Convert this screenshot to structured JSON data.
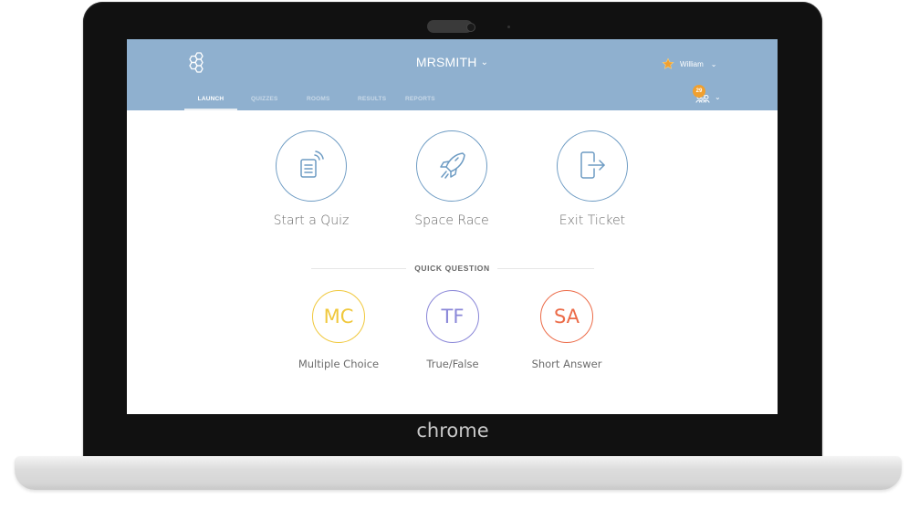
{
  "device": {
    "brand_label": "chrome"
  },
  "header": {
    "logo_icon": "hexagon-cluster-icon",
    "room_title": "MRSMITH",
    "room_chevron": "⌄",
    "tabs": [
      {
        "label": "LAUNCH",
        "active": true
      },
      {
        "label": "QUIZZES",
        "active": false
      },
      {
        "label": "ROOMS",
        "active": false
      },
      {
        "label": "RESULTS",
        "active": false
      },
      {
        "label": "REPORTS",
        "active": false
      }
    ],
    "user": {
      "icon": "star-icon",
      "name": "William",
      "chevron": "⌄"
    },
    "students": {
      "icon": "students-icon",
      "count": "29",
      "chevron": "⌄"
    }
  },
  "launch": {
    "items": [
      {
        "label": "Start a Quiz",
        "icon": "quiz-device-icon"
      },
      {
        "label": "Space Race",
        "icon": "rocket-icon"
      },
      {
        "label": "Exit Ticket",
        "icon": "exit-door-icon"
      }
    ],
    "accent_color": "#6d9bc3"
  },
  "quick_question": {
    "title": "QUICK QUESTION",
    "items": [
      {
        "abbr": "MC",
        "label": "Multiple Choice",
        "color": "#f0c83c"
      },
      {
        "abbr": "TF",
        "label": "True/False",
        "color": "#8a87d8"
      },
      {
        "abbr": "SA",
        "label": "Short Answer",
        "color": "#ec6b48"
      }
    ]
  },
  "colors": {
    "header_bg": "#8fb0cf",
    "badge": "#f0a030",
    "star": "#f0a030"
  }
}
